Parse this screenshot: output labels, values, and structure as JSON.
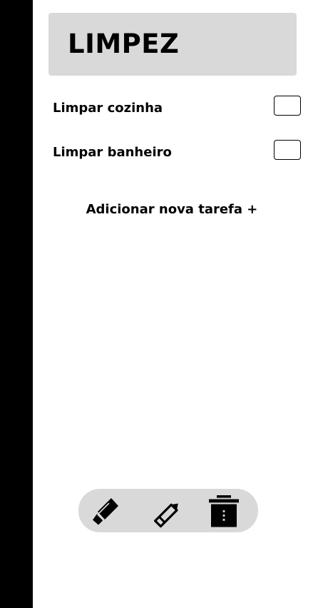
{
  "header": {
    "title": "LIMPEZ"
  },
  "tasks": [
    {
      "label": "Limpar cozinha",
      "checked": false
    },
    {
      "label": "Limpar banheiro",
      "checked": false
    }
  ],
  "add_task_label": "Adicionar nova tarefa +",
  "toolbar": {
    "buttons": [
      {
        "icon": "brush-icon"
      },
      {
        "icon": "pencil-icon"
      },
      {
        "icon": "trash-icon"
      }
    ]
  },
  "colors": {
    "sidebar": "#000000",
    "panel": "#d9d9d9",
    "text": "#000000",
    "background": "#ffffff"
  }
}
